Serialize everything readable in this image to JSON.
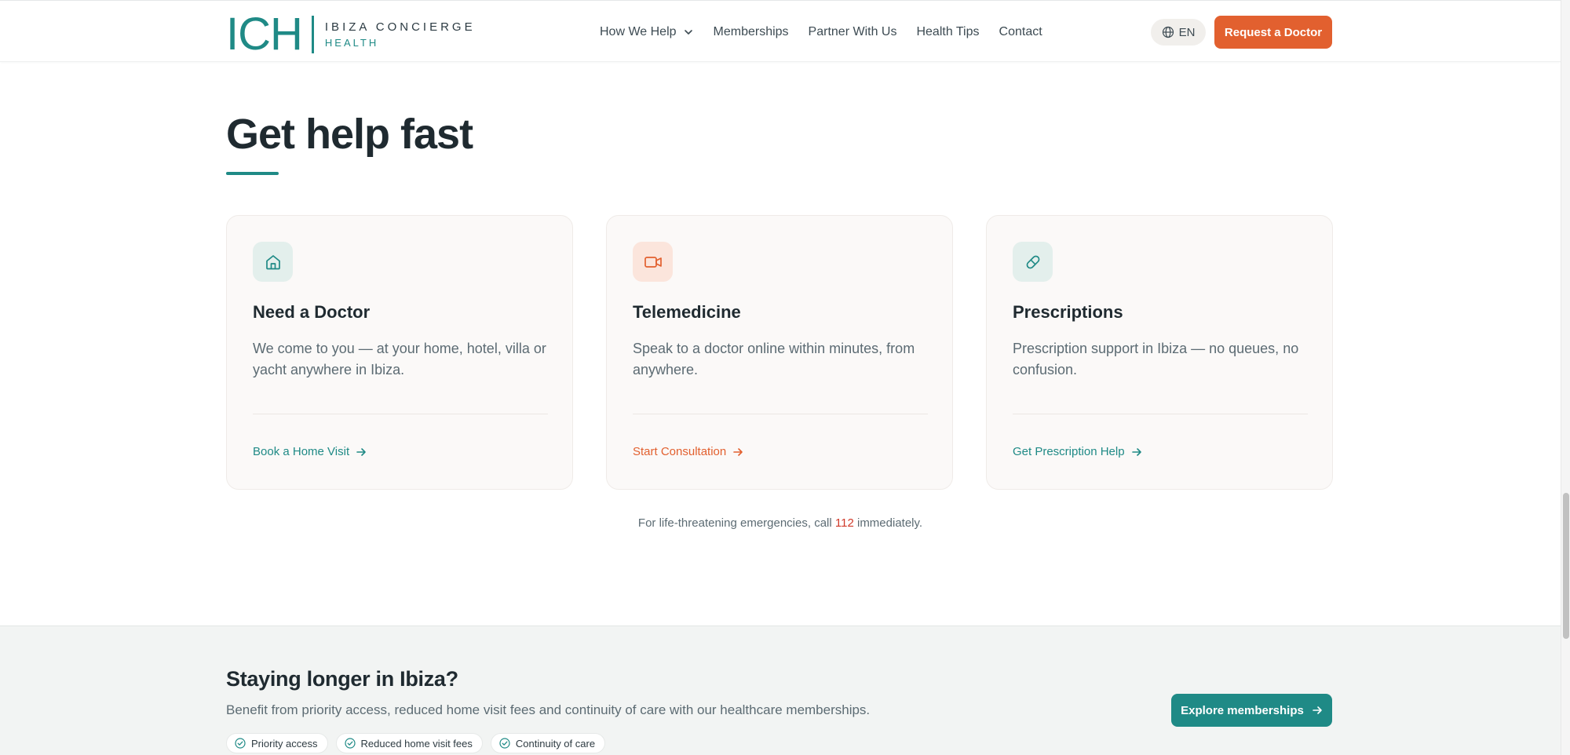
{
  "header": {
    "logo_mark": "ICH",
    "logo_line1": "IBIZA CONCIERGE",
    "logo_line2": "HEALTH",
    "nav": [
      {
        "label": "How We Help",
        "has_dropdown": true
      },
      {
        "label": "Memberships"
      },
      {
        "label": "Partner With Us"
      },
      {
        "label": "Health Tips"
      },
      {
        "label": "Contact"
      }
    ],
    "language": "EN",
    "cta_label": "Request a Doctor"
  },
  "section": {
    "title": "Get help fast"
  },
  "cards": [
    {
      "icon": "home-icon",
      "title": "Need a Doctor",
      "description": "We come to you — at your home, hotel, villa or yacht anywhere in Ibiza.",
      "link": "Book a Home Visit",
      "accent": "#1f8a86",
      "icon_bg": "#e3efec"
    },
    {
      "icon": "video-icon",
      "title": "Telemedicine",
      "description": "Speak to a doctor online within minutes, from anywhere.",
      "link": "Start Consultation",
      "accent": "#e2602f",
      "icon_bg": "#fbe5dc"
    },
    {
      "icon": "pill-icon",
      "title": "Prescriptions",
      "description": "Prescription support in Ibiza — no queues, no confusion.",
      "link": "Get Prescription Help",
      "accent": "#1f8a86",
      "icon_bg": "#e3efec"
    }
  ],
  "emergency": {
    "prefix": "For life-threatening emergencies, call",
    "number": "112",
    "suffix": "immediately."
  },
  "membership": {
    "title": "Staying longer in Ibiza?",
    "description": "Benefit from priority access, reduced home visit fees and continuity of care with our healthcare memberships.",
    "pills": [
      "Priority access",
      "Reduced home visit fees",
      "Continuity of care"
    ],
    "cta_label": "Explore memberships"
  },
  "colors": {
    "brand_teal": "#1f8a86",
    "brand_orange": "#e2602f",
    "emergency_red": "#d03a2a"
  }
}
